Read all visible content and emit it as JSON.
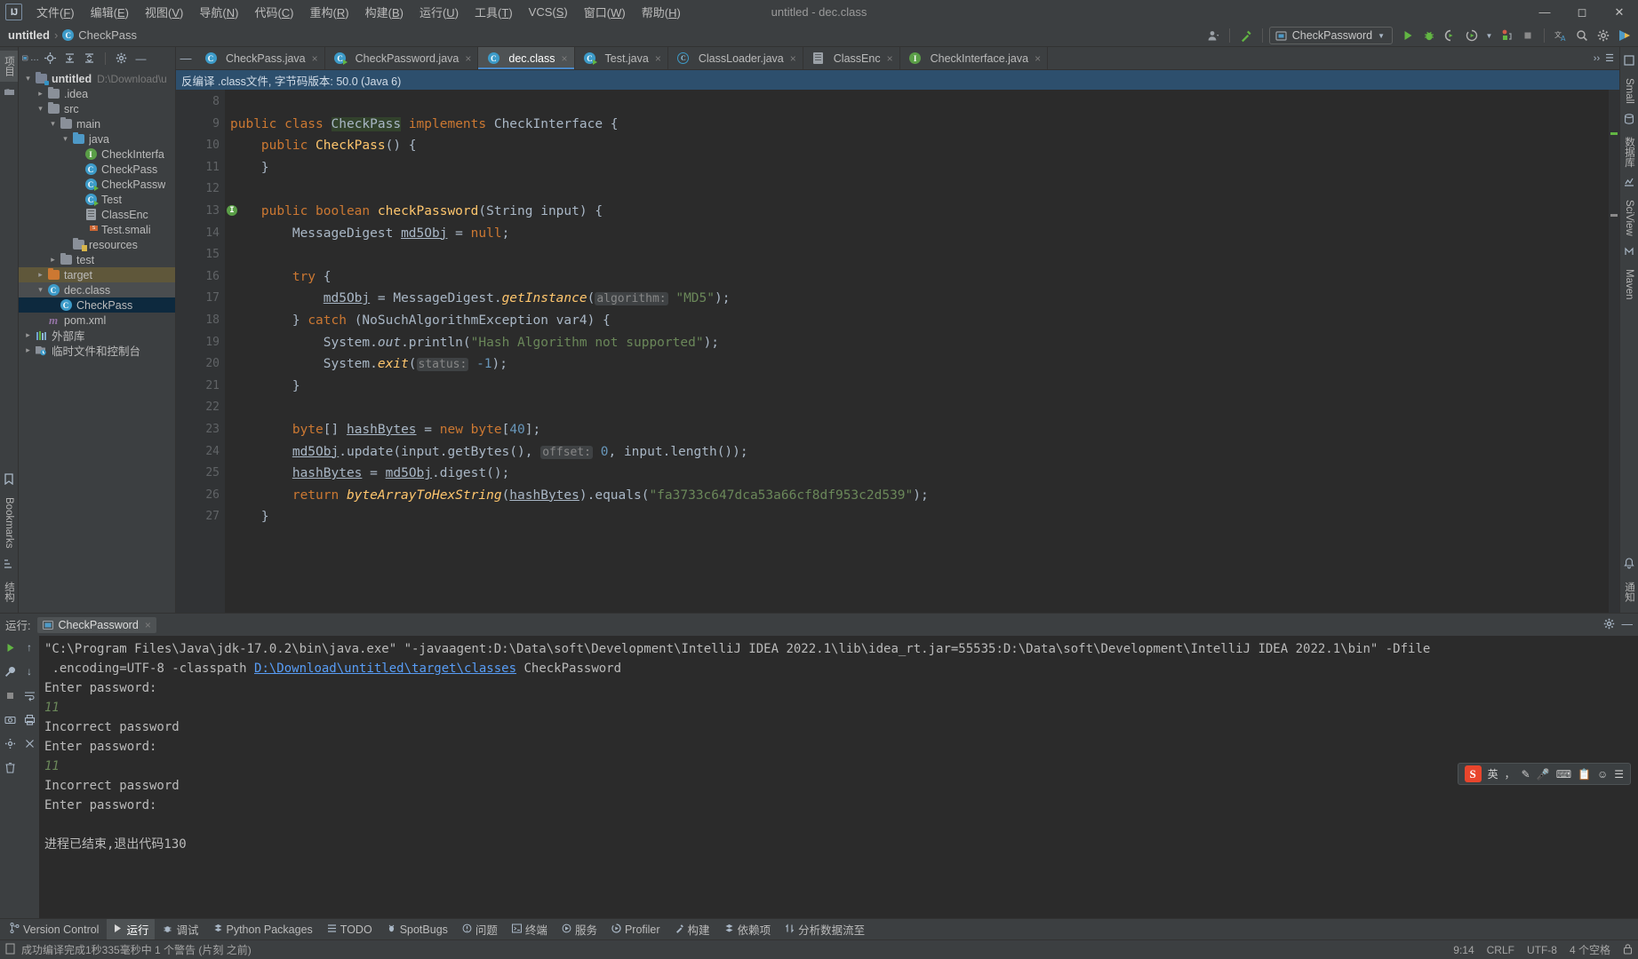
{
  "window": {
    "title": "untitled - dec.class",
    "logo": "IJ",
    "minimize": "minimize-icon",
    "maximize": "maximize-icon",
    "close": "close-icon"
  },
  "menu": [
    {
      "label": "文件(F)"
    },
    {
      "label": "编辑(E)"
    },
    {
      "label": "视图(V)"
    },
    {
      "label": "导航(N)"
    },
    {
      "label": "代码(C)"
    },
    {
      "label": "重构(R)"
    },
    {
      "label": "构建(B)"
    },
    {
      "label": "运行(U)"
    },
    {
      "label": "工具(T)"
    },
    {
      "label": "VCS(S)"
    },
    {
      "label": "窗口(W)"
    },
    {
      "label": "帮助(H)"
    }
  ],
  "breadcrumb": {
    "project": "untitled",
    "separator": "›",
    "class": "CheckPass"
  },
  "toolbar": {
    "run_config": "CheckPassword",
    "run_config_dropdown": "▼",
    "icons": [
      "user-icon",
      "hammer-icon",
      "run-icon",
      "debug-icon",
      "coverage-icon",
      "profiler-icon",
      "stop-icon",
      "translate-icon",
      "search-everywhere-icon",
      "settings-icon",
      "updates-icon"
    ]
  },
  "left_rail": {
    "items": [
      {
        "label": "项目",
        "name": "tool-project",
        "active": true
      },
      {
        "label": "提交",
        "name": "tool-commit",
        "active": false
      }
    ],
    "bottom": [
      {
        "label": "Bookmarks",
        "name": "tool-bookmarks"
      },
      {
        "label": "结构",
        "name": "tool-structure"
      }
    ]
  },
  "right_rail": {
    "items": [
      {
        "label": "Small",
        "name": "tool-small"
      },
      {
        "label": "数据库",
        "name": "tool-database"
      },
      {
        "label": "SciView",
        "name": "tool-sciview"
      },
      {
        "label": "Maven",
        "name": "tool-maven"
      }
    ],
    "bottom": [
      {
        "label": "通知",
        "name": "tool-notifications"
      }
    ]
  },
  "project_panel": {
    "header_buttons": [
      "project-view-selector",
      "locate-icon",
      "expand-all-icon",
      "collapse-all-icon",
      "settings-icon",
      "hide-icon"
    ],
    "tree": [
      {
        "depth": 0,
        "arrow": "⌄",
        "icon": "module-folder",
        "label": "untitled",
        "path": "D:\\Download\\u",
        "bold": true,
        "state": "none"
      },
      {
        "depth": 1,
        "arrow": "›",
        "icon": "folder",
        "label": ".idea",
        "state": "none"
      },
      {
        "depth": 1,
        "arrow": "⌄",
        "icon": "folder",
        "label": "src",
        "state": "none"
      },
      {
        "depth": 2,
        "arrow": "⌄",
        "icon": "folder",
        "label": "main",
        "state": "none"
      },
      {
        "depth": 3,
        "arrow": "⌄",
        "icon": "folder-source",
        "label": "java",
        "state": "none"
      },
      {
        "depth": 4,
        "arrow": "",
        "icon": "interface-icon",
        "label": "CheckInterfa",
        "state": "none"
      },
      {
        "depth": 4,
        "arrow": "",
        "icon": "class-icon",
        "label": "CheckPass",
        "state": "none"
      },
      {
        "depth": 4,
        "arrow": "",
        "icon": "class-runnable-icon",
        "label": "CheckPassw",
        "state": "none"
      },
      {
        "depth": 4,
        "arrow": "",
        "icon": "class-runnable-icon",
        "label": "Test",
        "state": "none"
      },
      {
        "depth": 4,
        "arrow": "",
        "icon": "file-icon",
        "label": "ClassEnc",
        "state": "none"
      },
      {
        "depth": 4,
        "arrow": "",
        "icon": "smali-icon",
        "label": "Test.smali",
        "state": "none"
      },
      {
        "depth": 3,
        "arrow": "",
        "icon": "resource-folder",
        "label": "resources",
        "state": "none"
      },
      {
        "depth": 2,
        "arrow": "›",
        "icon": "folder",
        "label": "test",
        "state": "none"
      },
      {
        "depth": 1,
        "arrow": "›",
        "icon": "folder-excluded",
        "label": "target",
        "state": "brown"
      },
      {
        "depth": 1,
        "arrow": "⌄",
        "icon": "class-icon",
        "label": "dec.class",
        "state": "grey"
      },
      {
        "depth": 2,
        "arrow": "",
        "icon": "class-icon",
        "label": "CheckPass",
        "state": "blue"
      },
      {
        "depth": 1,
        "arrow": "",
        "icon": "maven-icon",
        "label": "pom.xml",
        "state": "none"
      },
      {
        "depth": 0,
        "arrow": "›",
        "icon": "library-icon",
        "label": "外部库",
        "state": "none"
      },
      {
        "depth": 0,
        "arrow": "›",
        "icon": "scratch-icon",
        "label": "临时文件和控制台",
        "state": "none"
      }
    ]
  },
  "editor": {
    "tabs": [
      {
        "label": "CheckPass.java",
        "icon": "class-icon",
        "active": false
      },
      {
        "label": "CheckPassword.java",
        "icon": "class-runnable-icon",
        "active": false
      },
      {
        "label": "dec.class",
        "icon": "class-icon",
        "active": true
      },
      {
        "label": "Test.java",
        "icon": "class-runnable-icon",
        "active": false
      },
      {
        "label": "ClassLoader.java",
        "icon": "class-abstract-icon",
        "active": false
      },
      {
        "label": "ClassEnc",
        "icon": "file-icon",
        "active": false
      },
      {
        "label": "CheckInterface.java",
        "icon": "interface-icon",
        "active": false
      }
    ],
    "notification": "反编译 .class文件, 字节码版本: 50.0 (Java 6)",
    "first_line_number": 8,
    "lines": [
      {
        "num": 8,
        "tokens": []
      },
      {
        "num": 9,
        "tokens": [
          {
            "t": "public ",
            "c": "kw"
          },
          {
            "t": "class ",
            "c": "kw"
          },
          {
            "t": "CheckPass",
            "c": "sel-ident"
          },
          {
            "t": " "
          },
          {
            "t": "implements ",
            "c": "kw"
          },
          {
            "t": "CheckInterface {"
          }
        ]
      },
      {
        "num": 10,
        "tokens": [
          {
            "t": "    "
          },
          {
            "t": "public ",
            "c": "kw"
          },
          {
            "t": "CheckPass",
            "c": "mth"
          },
          {
            "t": "() {"
          }
        ]
      },
      {
        "num": 11,
        "tokens": [
          {
            "t": "    }"
          }
        ]
      },
      {
        "num": 12,
        "tokens": []
      },
      {
        "num": 13,
        "gmark": "I",
        "tokens": [
          {
            "t": "    "
          },
          {
            "t": "public ",
            "c": "kw"
          },
          {
            "t": "boolean ",
            "c": "kw"
          },
          {
            "t": "checkPassword",
            "c": "mth"
          },
          {
            "t": "(String input) {"
          }
        ]
      },
      {
        "num": 14,
        "tokens": [
          {
            "t": "        MessageDigest "
          },
          {
            "t": "md5Obj",
            "c": "fld"
          },
          {
            "t": " = "
          },
          {
            "t": "null",
            "c": "kw"
          },
          {
            "t": ";"
          }
        ]
      },
      {
        "num": 15,
        "tokens": []
      },
      {
        "num": 16,
        "tokens": [
          {
            "t": "        "
          },
          {
            "t": "try",
            "c": "kw"
          },
          {
            "t": " {"
          }
        ]
      },
      {
        "num": 17,
        "tokens": [
          {
            "t": "            "
          },
          {
            "t": "md5Obj",
            "c": "fld"
          },
          {
            "t": " = MessageDigest."
          },
          {
            "t": "getInstance",
            "c": "mthi"
          },
          {
            "t": "("
          },
          {
            "t": "algorithm:",
            "c": "hintp"
          },
          {
            "t": " "
          },
          {
            "t": "\"MD5\"",
            "c": "str"
          },
          {
            "t": ");"
          }
        ]
      },
      {
        "num": 18,
        "tokens": [
          {
            "t": "        } "
          },
          {
            "t": "catch",
            "c": "kw"
          },
          {
            "t": " (NoSuchAlgorithmException var4) {"
          }
        ]
      },
      {
        "num": 19,
        "tokens": [
          {
            "t": "            System."
          },
          {
            "t": "out",
            "c": "fldi"
          },
          {
            "t": ".println("
          },
          {
            "t": "\"Hash Algorithm not supported\"",
            "c": "str"
          },
          {
            "t": ");"
          }
        ]
      },
      {
        "num": 20,
        "tokens": [
          {
            "t": "            System."
          },
          {
            "t": "exit",
            "c": "mthi"
          },
          {
            "t": "("
          },
          {
            "t": "status:",
            "c": "hintp"
          },
          {
            "t": " "
          },
          {
            "t": "-1",
            "c": "num"
          },
          {
            "t": ");"
          }
        ]
      },
      {
        "num": 21,
        "tokens": [
          {
            "t": "        }"
          }
        ]
      },
      {
        "num": 22,
        "tokens": []
      },
      {
        "num": 23,
        "tokens": [
          {
            "t": "        "
          },
          {
            "t": "byte",
            "c": "kw"
          },
          {
            "t": "[] "
          },
          {
            "t": "hashBytes",
            "c": "fld"
          },
          {
            "t": " = "
          },
          {
            "t": "new ",
            "c": "kw"
          },
          {
            "t": "byte",
            "c": "kw"
          },
          {
            "t": "["
          },
          {
            "t": "40",
            "c": "num"
          },
          {
            "t": "];"
          }
        ]
      },
      {
        "num": 24,
        "tokens": [
          {
            "t": "        "
          },
          {
            "t": "md5Obj",
            "c": "fld"
          },
          {
            "t": ".update(input.getBytes(), "
          },
          {
            "t": "offset:",
            "c": "hintp"
          },
          {
            "t": " "
          },
          {
            "t": "0",
            "c": "num"
          },
          {
            "t": ", input.length());"
          }
        ]
      },
      {
        "num": 25,
        "tokens": [
          {
            "t": "        "
          },
          {
            "t": "hashBytes",
            "c": "fld"
          },
          {
            "t": " = "
          },
          {
            "t": "md5Obj",
            "c": "fld"
          },
          {
            "t": ".digest();"
          }
        ]
      },
      {
        "num": 26,
        "tokens": [
          {
            "t": "        "
          },
          {
            "t": "return ",
            "c": "kw"
          },
          {
            "t": "byteArrayToHexString",
            "c": "mthi"
          },
          {
            "t": "("
          },
          {
            "t": "hashBytes",
            "c": "fld"
          },
          {
            "t": ").equals("
          },
          {
            "t": "\"fa3733c647dca53a66cf8df953c2d539\"",
            "c": "str"
          },
          {
            "t": ");"
          }
        ]
      },
      {
        "num": 27,
        "tokens": [
          {
            "t": "    }"
          }
        ]
      }
    ]
  },
  "run_panel": {
    "label": "运行:",
    "tab": "CheckPassword",
    "tab_close": "×",
    "side_icons": [
      "run-icon",
      "rerun-icon",
      "stop-icon",
      "camera-icon",
      "settings-icon",
      "trash-icon",
      "scroll-up-icon",
      "scroll-down-icon",
      "soft-wrap-icon",
      "print-icon",
      "clear-icon"
    ],
    "console": [
      {
        "type": "sys",
        "text": "\"C:\\Program Files\\Java\\jdk-17.0.2\\bin\\java.exe\" \"-javaagent:D:\\Data\\soft\\Development\\IntelliJ IDEA 2022.1\\lib\\idea_rt.jar=55535:D:\\Data\\soft\\Development\\IntelliJ IDEA 2022.1\\bin\" -Dfile"
      },
      {
        "type": "mixed",
        "prefix": " .encoding=UTF-8 -classpath ",
        "link": "D:\\Download\\untitled\\target\\classes",
        "suffix": " CheckPassword"
      },
      {
        "type": "sys",
        "text": "Enter password:"
      },
      {
        "type": "in",
        "text": "11"
      },
      {
        "type": "sys",
        "text": "Incorrect password"
      },
      {
        "type": "sys",
        "text": "Enter password:"
      },
      {
        "type": "in",
        "text": "11"
      },
      {
        "type": "sys",
        "text": "Incorrect password"
      },
      {
        "type": "sys",
        "text": "Enter password:"
      },
      {
        "type": "sys",
        "text": ""
      },
      {
        "type": "sys",
        "text": "进程已结束,退出代码130"
      }
    ]
  },
  "ime": {
    "logo": "S",
    "mode": "英",
    "icons": [
      "comma-period-icon",
      "pen-icon",
      "mic-icon",
      "keyboard-icon",
      "clipboard-icon",
      "emoji-icon",
      "menu-icon"
    ]
  },
  "tool_window_bar": [
    {
      "label": "Version Control",
      "icon": "branch-icon",
      "active": false
    },
    {
      "label": "运行",
      "icon": "run-icon",
      "active": true
    },
    {
      "label": "调试",
      "icon": "debug-icon",
      "active": false
    },
    {
      "label": "Python Packages",
      "icon": "packages-icon",
      "active": false
    },
    {
      "label": "TODO",
      "icon": "todo-icon",
      "active": false
    },
    {
      "label": "SpotBugs",
      "icon": "bug-icon",
      "active": false
    },
    {
      "label": "问题",
      "icon": "problems-icon",
      "active": false
    },
    {
      "label": "终端",
      "icon": "terminal-icon",
      "active": false
    },
    {
      "label": "服务",
      "icon": "services-icon",
      "active": false
    },
    {
      "label": "Profiler",
      "icon": "profiler-icon",
      "active": false
    },
    {
      "label": "构建",
      "icon": "build-icon",
      "active": false
    },
    {
      "label": "依赖项",
      "icon": "dependencies-icon",
      "active": false
    },
    {
      "label": "分析数据流至",
      "icon": "dataflow-icon",
      "active": false
    }
  ],
  "status_bar": {
    "message": "成功编译完成1秒335毫秒中 1 个警告 (片刻 之前)",
    "caret": "9:14",
    "line_sep": "CRLF",
    "encoding": "UTF-8",
    "indent": "4 个空格",
    "lock_icon": "lock-icon"
  },
  "colors": {
    "accent_blue": "#4a88c7",
    "notification_blue": "#2d4f6d",
    "selection_blue": "#0d293e",
    "excluded_brown": "#5f573a",
    "editor_bg": "#2b2b2b",
    "panel_bg": "#3c3f41",
    "keyword_orange": "#cc7832",
    "string_green": "#6a8759",
    "method_yellow": "#ffc66d",
    "number_blue": "#6897bb",
    "ime_red": "#e8452c"
  }
}
